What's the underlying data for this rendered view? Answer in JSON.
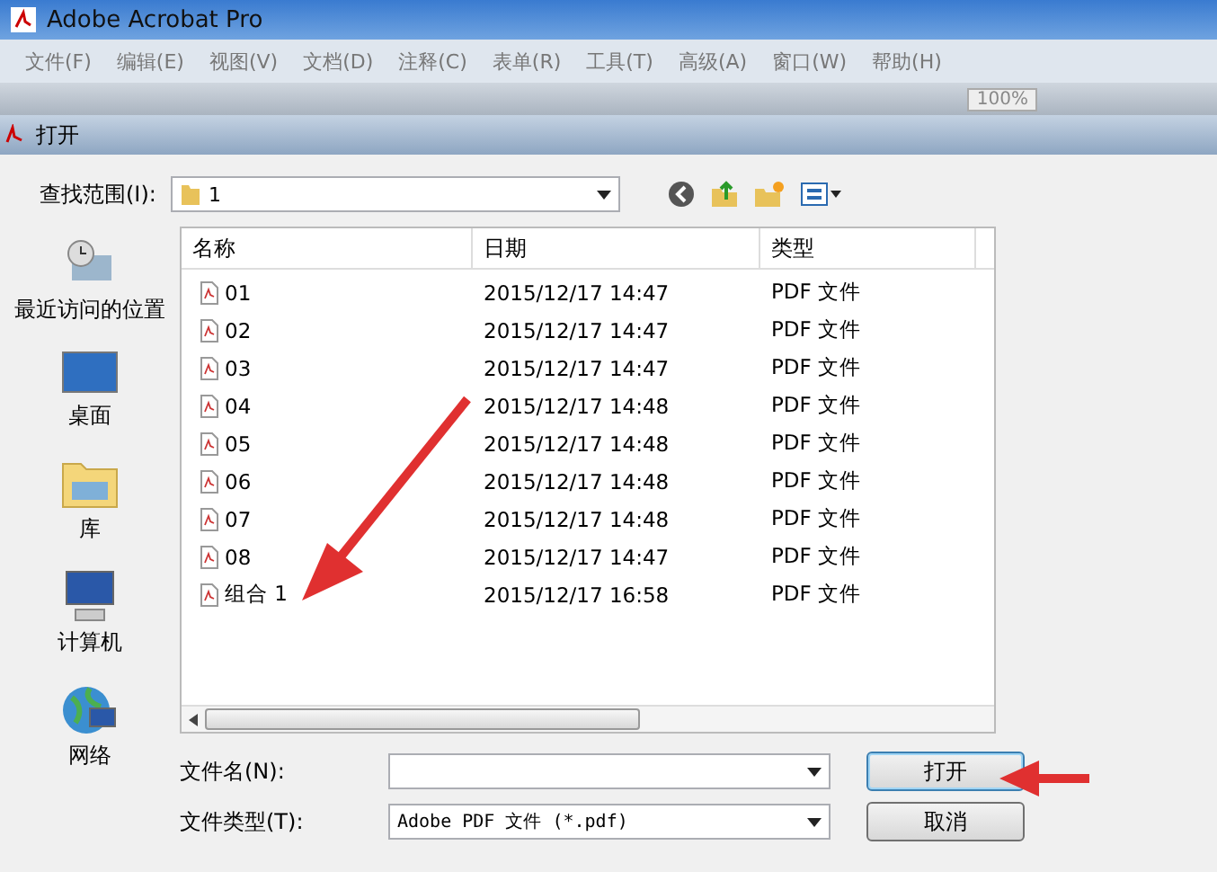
{
  "app_window": {
    "title": "Adobe Acrobat Pro",
    "menu": [
      "文件(F)",
      "编辑(E)",
      "视图(V)",
      "文档(D)",
      "注释(C)",
      "表单(R)",
      "工具(T)",
      "高级(A)",
      "窗口(W)",
      "帮助(H)"
    ],
    "zoom_value": "100%"
  },
  "dialog": {
    "title": "打开",
    "look_in_label": "查找范围(I):",
    "look_in_value": "1",
    "places": [
      {
        "label": "最近访问的位置",
        "kind": "recent"
      },
      {
        "label": "桌面",
        "kind": "desktop"
      },
      {
        "label": "库",
        "kind": "library"
      },
      {
        "label": "计算机",
        "kind": "computer"
      },
      {
        "label": "网络",
        "kind": "network"
      }
    ],
    "columns": [
      "名称",
      "日期",
      "类型"
    ],
    "rows": [
      {
        "name": "01",
        "date": "2015/12/17 14:47",
        "type": "PDF 文件"
      },
      {
        "name": "02",
        "date": "2015/12/17 14:47",
        "type": "PDF 文件"
      },
      {
        "name": "03",
        "date": "2015/12/17 14:47",
        "type": "PDF 文件"
      },
      {
        "name": "04",
        "date": "2015/12/17 14:48",
        "type": "PDF 文件"
      },
      {
        "name": "05",
        "date": "2015/12/17 14:48",
        "type": "PDF 文件"
      },
      {
        "name": "06",
        "date": "2015/12/17 14:48",
        "type": "PDF 文件"
      },
      {
        "name": "07",
        "date": "2015/12/17 14:48",
        "type": "PDF 文件"
      },
      {
        "name": "08",
        "date": "2015/12/17 14:47",
        "type": "PDF 文件"
      },
      {
        "name": "组合 1",
        "date": "2015/12/17 16:58",
        "type": "PDF 文件"
      }
    ],
    "file_name_label": "文件名(N):",
    "file_type_label": "文件类型(T):",
    "file_type_value": "Adobe PDF 文件 (*.pdf)",
    "buttons": [
      {
        "label": "打开",
        "kind": "primary"
      },
      {
        "label": "取消",
        "kind": "normal"
      }
    ]
  }
}
